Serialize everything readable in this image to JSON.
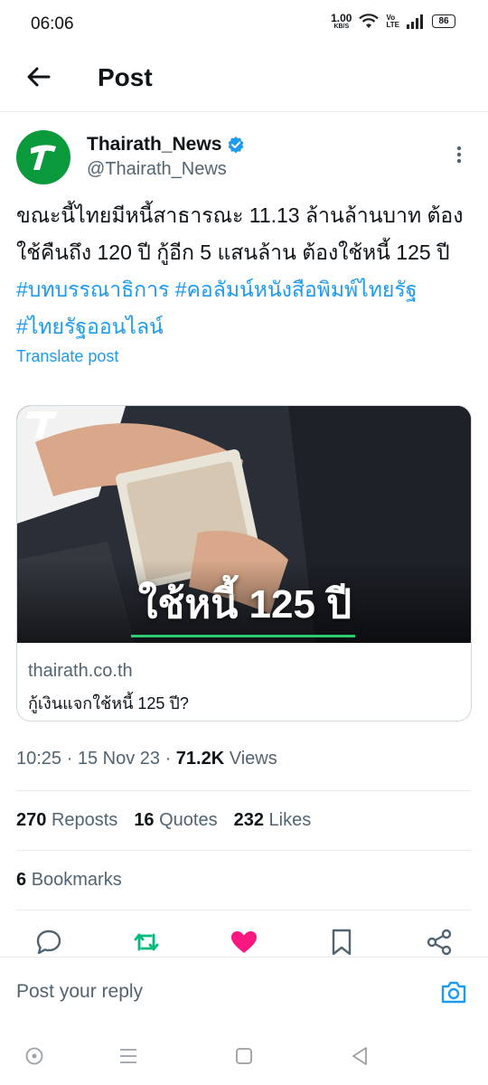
{
  "status_bar": {
    "time": "06:06",
    "net_speed_value": "1.00",
    "net_speed_unit": "KB/S",
    "volte_top": "Vo",
    "volte_bottom": "LTE",
    "battery": "86"
  },
  "header": {
    "title": "Post",
    "back_icon": "arrow-left-icon"
  },
  "author": {
    "name": "Thairath_News",
    "handle": "@Thairath_News",
    "verified": true,
    "avatar_letter": "T",
    "avatar_color": "#0a9a3c"
  },
  "post": {
    "text": "ขณะนี้ไทยมีหนี้สาธารณะ 11.13 ล้านล้านบาท ต้องใช้คืนถึง 120 ปี กู้อีก 5 แสนล้าน ต้องใช้หนี้ 125 ปี ",
    "hashtags": [
      "#บทบรรณาธิการ",
      "#คอลัมน์หนังสือพิมพ์ไทยรัฐ",
      "#ไทยรัฐออนไลน์"
    ],
    "translate_label": "Translate post"
  },
  "card": {
    "headline": "ใช้หนี้ 125 ปี",
    "domain": "thairath.co.th",
    "title": "กู้เงินแจกใช้หนี้ 125 ปี?"
  },
  "meta": {
    "time": "10:25",
    "date": "15 Nov 23",
    "views_count": "71.2K",
    "views_label": "Views"
  },
  "stats": {
    "reposts_count": "270",
    "reposts_label": "Reposts",
    "quotes_count": "16",
    "quotes_label": "Quotes",
    "likes_count": "232",
    "likes_label": "Likes",
    "bookmarks_count": "6",
    "bookmarks_label": "Bookmarks"
  },
  "actions": {
    "reply_icon": "reply-icon",
    "repost_icon": "repost-icon",
    "like_icon": "heart-icon",
    "bookmark_icon": "bookmark-icon",
    "share_icon": "share-icon",
    "repost_color": "#00ba7c",
    "like_color": "#f91880"
  },
  "reply": {
    "placeholder": "Post your reply"
  },
  "colors": {
    "link": "#1d9bf0",
    "secondary_text": "#536471",
    "verified": "#1d9bf0"
  }
}
